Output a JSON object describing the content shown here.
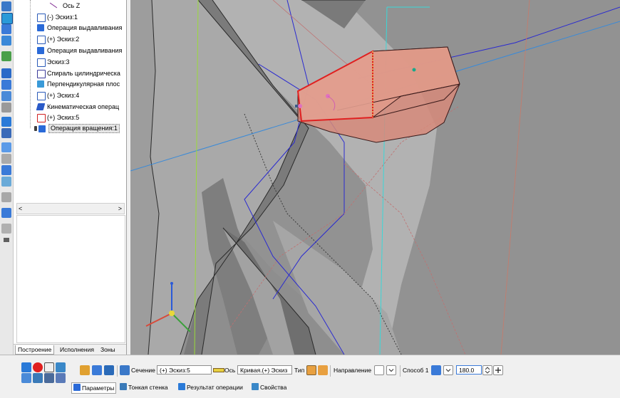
{
  "tree": {
    "items": [
      {
        "label": "Ось Z",
        "icon": "axis-icon"
      },
      {
        "label": "(-) Эскиз:1",
        "icon": "sketch-icon"
      },
      {
        "label": "Операция выдавливания",
        "icon": "extrude-icon"
      },
      {
        "label": "(+) Эскиз:2",
        "icon": "sketch-icon"
      },
      {
        "label": "Операция выдавливания",
        "icon": "extrude-icon"
      },
      {
        "label": "Эскиз:3",
        "icon": "sketch-icon"
      },
      {
        "label": "Спираль цилиндрическа",
        "icon": "spiral-icon"
      },
      {
        "label": "Перпендикулярная плос",
        "icon": "plane-icon"
      },
      {
        "label": "(+) Эскиз:4",
        "icon": "sketch-icon"
      },
      {
        "label": "Кинематическая операц",
        "icon": "sweep-icon"
      },
      {
        "label": "(+) Эскиз:5",
        "icon": "sketch-icon"
      },
      {
        "label": "Операция вращения:1",
        "icon": "revolve-icon"
      }
    ],
    "scroll_left": "<",
    "scroll_right": ">",
    "tabs": [
      "Построение",
      "Исполнения",
      "Зоны"
    ]
  },
  "properties": {
    "section_label": "Сечение",
    "section_value": "(+) Эскиз:5",
    "axis_label": "Ось",
    "axis_value": "Кривая.(+) Эскиз",
    "type_label": "Тип",
    "direction_label": "Направление",
    "method_label": "Способ 1",
    "angle_value": "180.0"
  },
  "bottom_tabs": {
    "params": "Параметры",
    "thin_wall": "Тонкая стенка",
    "result": "Результат операции",
    "props": "Свойства"
  },
  "colors": {
    "viewport_bg": "#8f8f8f",
    "preview_fill": "#d88a7a",
    "selection_red": "#e02020",
    "axis_blue": "#2020d0"
  }
}
